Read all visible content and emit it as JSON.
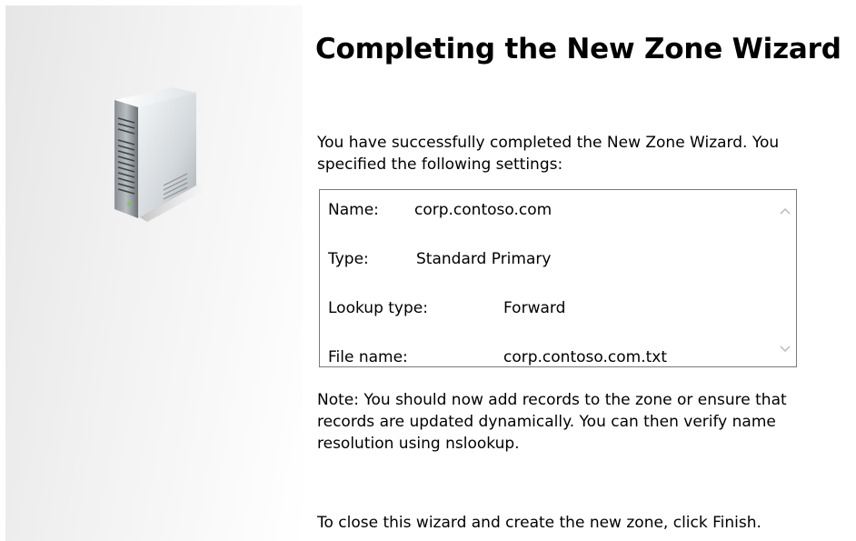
{
  "wizard": {
    "title": "Completing the New Zone Wizard",
    "intro_text": "You have successfully completed the New Zone Wizard. You specified the following settings:",
    "settings": [
      {
        "label": "Name:",
        "value": "corp.contoso.com"
      },
      {
        "label": "Type:",
        "value": "Standard Primary"
      },
      {
        "label": "Lookup type:",
        "value": "Forward"
      },
      {
        "label": "File name:",
        "value": "corp.contoso.com.txt"
      }
    ],
    "note_text": "Note: You should now add records to the zone or ensure that records are updated dynamically. You can then verify name resolution using nslookup.",
    "finish_text": "To close this wizard and create the new zone, click Finish."
  },
  "icons": {
    "side_image": "server-icon",
    "scroll_up": "chevron-up-icon",
    "scroll_down": "chevron-down-icon"
  },
  "colors": {
    "background": "#ffffff",
    "box_border": "#7a7a7a",
    "scroll_arrow": "#c0c0c0"
  }
}
